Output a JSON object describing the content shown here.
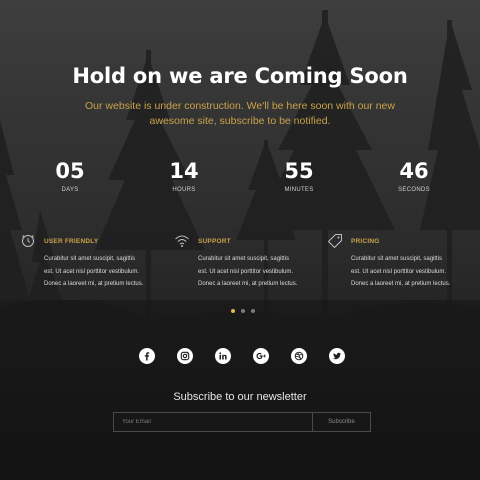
{
  "hero": {
    "title": "Hold on we are Coming Soon",
    "subtitle": "Our website is under construction. We'll be here soon with our new awesome site, subscribe to be notified."
  },
  "countdown": [
    {
      "value": "05",
      "label": "DAYS"
    },
    {
      "value": "14",
      "label": "HOURS"
    },
    {
      "value": "55",
      "label": "MINUTES"
    },
    {
      "value": "46",
      "label": "SECONDS"
    }
  ],
  "features": [
    {
      "icon": "clock-icon",
      "title": "USER FRIENDLY",
      "text": "Curabitur sit amet suscipit, sagittis est. Ut acet nisl porttitor vestibulum. Donec a laoreet mi, at pretium lectus."
    },
    {
      "icon": "wifi-icon",
      "title": "SUPPORT",
      "text": "Curabitur sit amet suscipit, sagittis est. Ut acet nisl porttitor vestibulum. Donec a laoreet mi, at pretium lectus."
    },
    {
      "icon": "tag-icon",
      "title": "PRICING",
      "text": "Curabitur sit amet suscipit, sagittis est. Ut acet nisl porttitor vestibulum. Donec a laoreet mi, at pretium lectus."
    }
  ],
  "carousel": {
    "count": 3,
    "active": 0
  },
  "social": [
    "facebook-icon",
    "instagram-icon",
    "linkedin-icon",
    "google-plus-icon",
    "dribbble-icon",
    "twitter-icon"
  ],
  "newsletter": {
    "title": "Subscribe to our newsletter",
    "placeholder": "Your Email",
    "button": "Subscribe"
  },
  "colors": {
    "accent": "#c9a24a",
    "active_dot": "#e3b450"
  }
}
